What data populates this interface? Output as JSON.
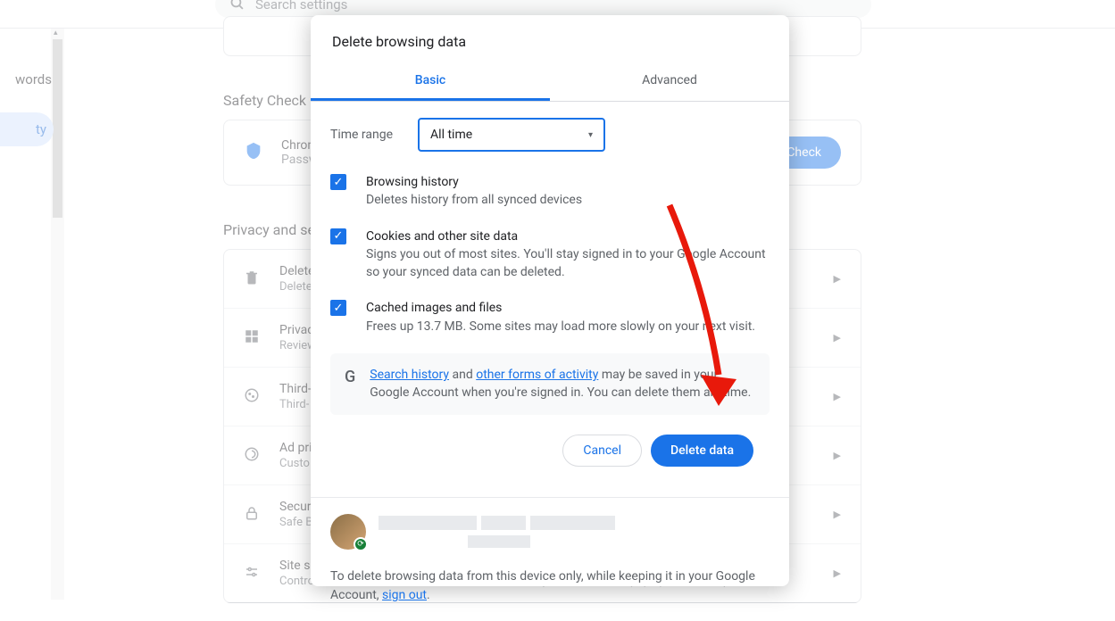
{
  "search": {
    "placeholder": "Search settings"
  },
  "nav": {
    "item0": "words",
    "item1": "ty"
  },
  "sections": {
    "safety": "Safety Check",
    "privacy": "Privacy and se"
  },
  "safetyCard": {
    "title": "Chrom",
    "sub": "Passwo",
    "button": "y Check"
  },
  "rows": [
    {
      "title": "Delete",
      "sub": "Delete"
    },
    {
      "title": "Privacy",
      "sub": "Review"
    },
    {
      "title": "Third-",
      "sub": "Third-"
    },
    {
      "title": "Ad pri",
      "sub": "Custo"
    },
    {
      "title": "Securi",
      "sub": "Safe B"
    },
    {
      "title": "Site settings",
      "sub": "Controls what information sites can use and show (location camera pop ups and more)"
    }
  ],
  "dialog": {
    "title": "Delete browsing data",
    "tabs": {
      "basic": "Basic",
      "advanced": "Advanced"
    },
    "timeRange": {
      "label": "Time range",
      "value": "All time"
    },
    "items": [
      {
        "title": "Browsing history",
        "desc": "Deletes history from all synced devices"
      },
      {
        "title": "Cookies and other site data",
        "desc": "Signs you out of most sites. You'll stay signed in to your Google Account so your synced data can be deleted."
      },
      {
        "title": "Cached images and files",
        "desc": "Frees up 13.7 MB. Some sites may load more slowly on your next visit."
      }
    ],
    "info": {
      "link1": "Search history",
      "mid": " and ",
      "link2": "other forms of activity",
      "rest": " may be saved in your Google Account when you're signed in. You can delete them anytime."
    },
    "actions": {
      "cancel": "Cancel",
      "delete": "Delete data"
    },
    "account": {
      "text1": "To delete browsing data from this device only, while keeping it in your Google Account, ",
      "signout": "sign out",
      "text2": "."
    }
  }
}
